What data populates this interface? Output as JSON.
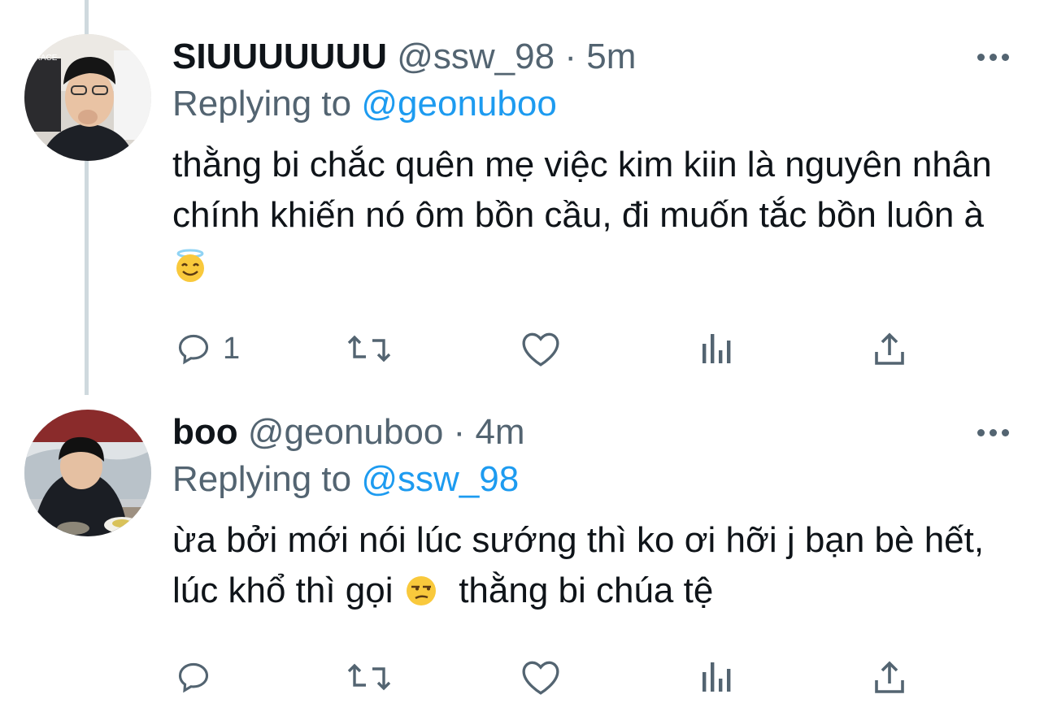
{
  "tweets": [
    {
      "display_name": "SIUUUUUUU",
      "handle": "@ssw_98",
      "separator": "·",
      "time": "5m",
      "replying_label": "Replying to",
      "replying_to": "@geonuboo",
      "text_main": "thằng bi chắc quên mẹ việc kim kiin là nguyên nhân chính khiến nó ôm bồn cầu, đi muốn tắc bồn luôn à",
      "emoji_1": "smiling-face-with-halo",
      "text_after_emoji": "",
      "reply_count": "1"
    },
    {
      "display_name": "boo",
      "handle": "@geonuboo",
      "separator": "·",
      "time": "4m",
      "replying_label": "Replying to",
      "replying_to": "@ssw_98",
      "text_main": "ừa bởi mới nói lúc sướng thì ko ơi hỡi j bạn bè hết, lúc khổ thì gọi",
      "emoji_1": "unamused-face",
      "text_after_emoji": "thằng bi chúa tệ",
      "reply_count": ""
    }
  ],
  "colors": {
    "accent": "#1d9bf0",
    "muted": "#536471",
    "text": "#0f1419",
    "thread_line": "#cfd9de"
  }
}
